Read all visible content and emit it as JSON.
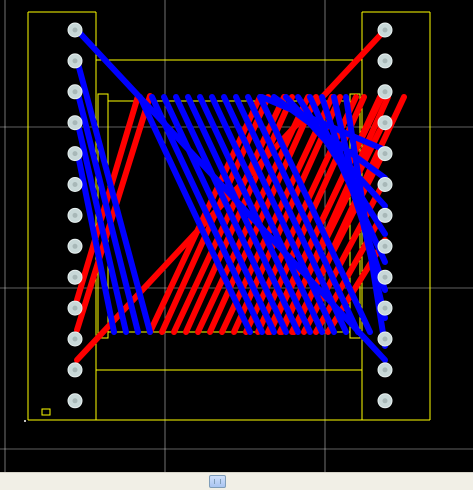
{
  "view": {
    "background": "#000000",
    "grid_color": "#ffffff",
    "outline_color": "#ffff00"
  },
  "traces": {
    "top_layer_color": "#ff0000",
    "bottom_layer_color": "#0000ff",
    "top_layer_trace_count": 14,
    "bottom_layer_trace_count": 15
  },
  "pads": {
    "color": "#c8d8d8",
    "left_column_count": 13,
    "right_column_count": 13
  },
  "scrollbar": {
    "thumb_color": "#b9cff6",
    "track_color": "#f1efe6"
  }
}
